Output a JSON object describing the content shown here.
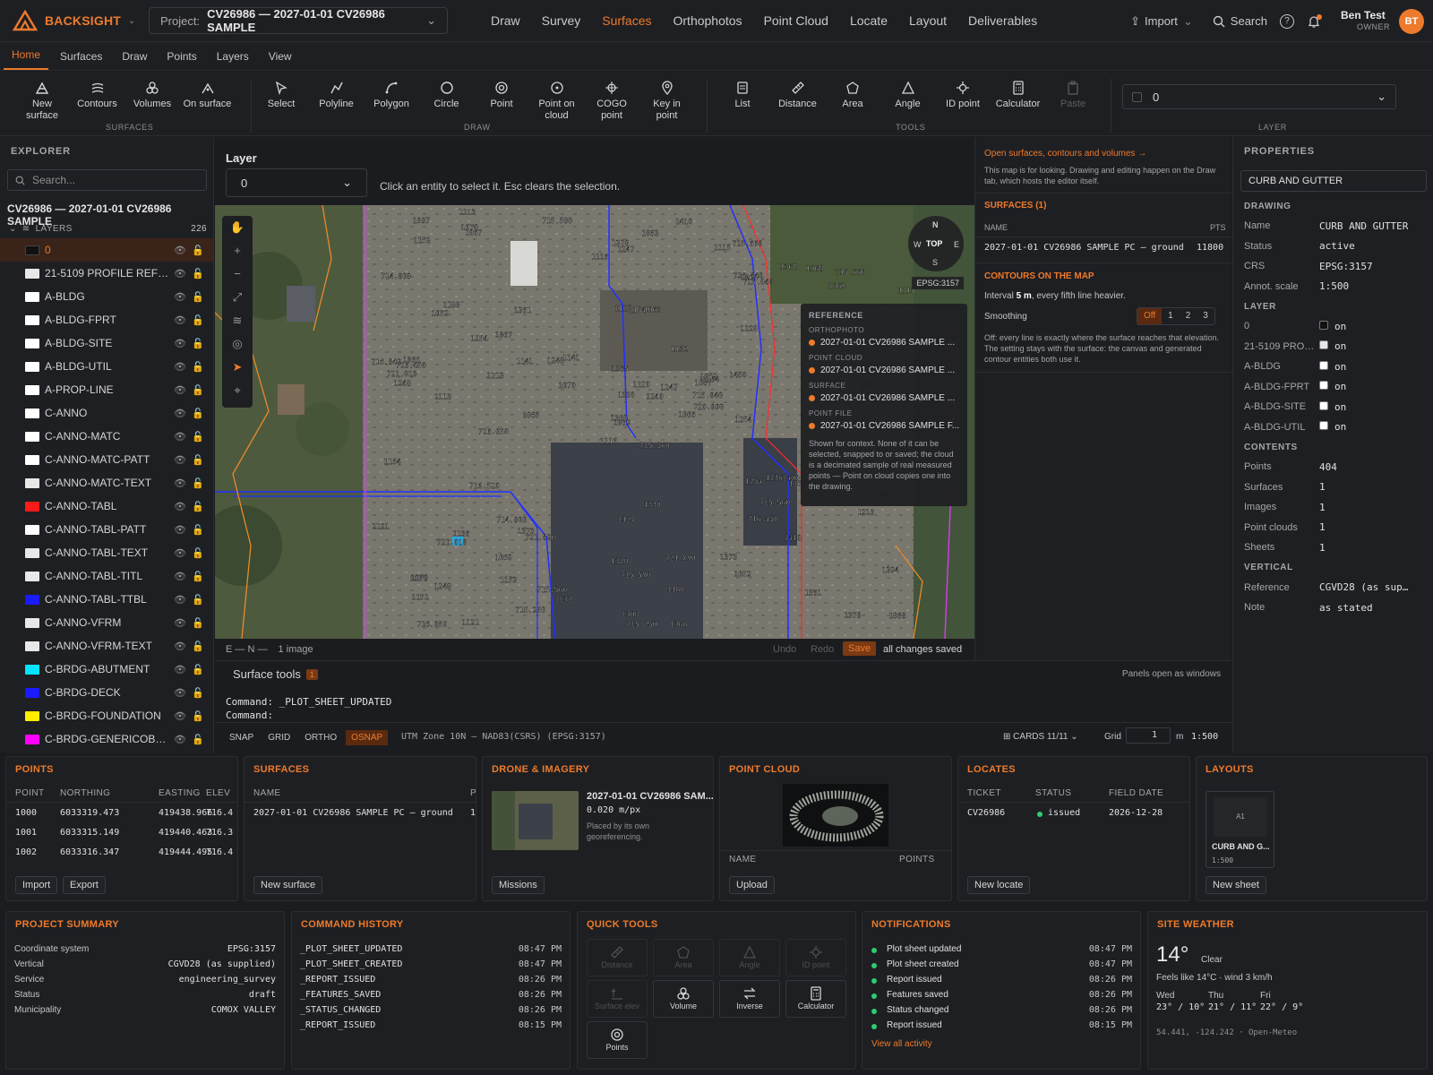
{
  "app": {
    "brand": "BACKSIGHT",
    "project_label": "Project:",
    "project_value": "CV26986 — 2027-01-01 CV26986 SAMPLE",
    "nav": [
      "Draw",
      "Survey",
      "Surfaces",
      "Orthophotos",
      "Point Cloud",
      "Locate",
      "Layout",
      "Deliverables"
    ],
    "nav_active": "Surfaces",
    "import_label": "Import",
    "search_label": "Search",
    "user_name": "Ben Test",
    "user_role": "OWNER",
    "user_initials": "BT",
    "accent_color": "#ee7a2c"
  },
  "ribbon_tabs": [
    "Home",
    "Surfaces",
    "Draw",
    "Points",
    "Layers",
    "View"
  ],
  "ribbon": {
    "surfaces": {
      "group": "SURFACES",
      "buttons": [
        {
          "label": "New\nsurface",
          "icon": "surface-icon"
        },
        {
          "label": "Contours",
          "icon": "contours-icon"
        },
        {
          "label": "Volumes",
          "icon": "volumes-icon"
        },
        {
          "label": "On surface",
          "icon": "on-surface-icon"
        }
      ]
    },
    "draw": {
      "group": "DRAW",
      "buttons": [
        {
          "label": "Select",
          "icon": "cursor-icon"
        },
        {
          "label": "Polyline",
          "icon": "polyline-icon"
        },
        {
          "label": "Polygon",
          "icon": "polygon-icon"
        },
        {
          "label": "Circle",
          "icon": "circle-icon"
        },
        {
          "label": "Point",
          "icon": "point-icon"
        },
        {
          "label": "Point on\ncloud",
          "icon": "point-on-cloud-icon"
        },
        {
          "label": "COGO\npoint",
          "icon": "cogo-icon"
        },
        {
          "label": "Key in\npoint",
          "icon": "key-in-icon"
        }
      ]
    },
    "tools": {
      "group": "TOOLS",
      "buttons": [
        {
          "label": "List",
          "icon": "list-icon"
        },
        {
          "label": "Distance",
          "icon": "ruler-icon"
        },
        {
          "label": "Area",
          "icon": "area-icon"
        },
        {
          "label": "Angle",
          "icon": "angle-icon"
        },
        {
          "label": "ID point",
          "icon": "id-point-icon"
        },
        {
          "label": "Calculator",
          "icon": "calculator-icon"
        },
        {
          "label": "Paste",
          "icon": "paste-icon"
        }
      ]
    },
    "layer": {
      "group": "LAYER",
      "value": "0"
    }
  },
  "explorer": {
    "title": "EXPLORER",
    "search_placeholder": "Search...",
    "project": "CV26986 — 2027-01-01 CV26986 SAMPLE",
    "layers_label": "LAYERS",
    "layers_count": "226",
    "layers": [
      {
        "name": "0",
        "color": "#111111",
        "active": true
      },
      {
        "name": "21-5109 PROFILE REFERE...",
        "color": "#e8e8e8"
      },
      {
        "name": "A-BLDG",
        "color": "#ffffff"
      },
      {
        "name": "A-BLDG-FPRT",
        "color": "#ffffff"
      },
      {
        "name": "A-BLDG-SITE",
        "color": "#ffffff"
      },
      {
        "name": "A-BLDG-UTIL",
        "color": "#ffffff"
      },
      {
        "name": "A-PROP-LINE",
        "color": "#ffffff"
      },
      {
        "name": "C-ANNO",
        "color": "#ffffff"
      },
      {
        "name": "C-ANNO-MATC",
        "color": "#ffffff"
      },
      {
        "name": "C-ANNO-MATC-PATT",
        "color": "#ffffff"
      },
      {
        "name": "C-ANNO-MATC-TEXT",
        "color": "#e8e8e8"
      },
      {
        "name": "C-ANNO-TABL",
        "color": "#ff1a1a"
      },
      {
        "name": "C-ANNO-TABL-PATT",
        "color": "#ffffff"
      },
      {
        "name": "C-ANNO-TABL-TEXT",
        "color": "#e8e8e8"
      },
      {
        "name": "C-ANNO-TABL-TITL",
        "color": "#e8e8e8"
      },
      {
        "name": "C-ANNO-TABL-TTBL",
        "color": "#1a1aff"
      },
      {
        "name": "C-ANNO-VFRM",
        "color": "#e8e8e8"
      },
      {
        "name": "C-ANNO-VFRM-TEXT",
        "color": "#e8e8e8"
      },
      {
        "name": "C-BRDG-ABUTMENT",
        "color": "#00e5ff"
      },
      {
        "name": "C-BRDG-DECK",
        "color": "#1a1aff"
      },
      {
        "name": "C-BRDG-FOUNDATION",
        "color": "#ffee00"
      },
      {
        "name": "C-BRDG-GENERICOBJECT",
        "color": "#ff00ff"
      }
    ]
  },
  "center": {
    "layer_label": "Layer",
    "layer_value": "0",
    "hint": "Click an entity to select it. Esc clears the selection.",
    "compass": {
      "n": "N",
      "s": "S",
      "e": "E",
      "w": "W",
      "mode": "TOP"
    },
    "epsg_tag": "EPSG:3157",
    "reference": {
      "title": "REFERENCE",
      "items": [
        {
          "cat": "ORTHOPHOTO",
          "name": "2027-01-01 CV26986 SAMPLE ..."
        },
        {
          "cat": "POINT CLOUD",
          "name": "2027-01-01 CV26986 SAMPLE ..."
        },
        {
          "cat": "SURFACE",
          "name": "2027-01-01 CV26986 SAMPLE ..."
        },
        {
          "cat": "POINT FILE",
          "name": "2027-01-01 CV26986 SAMPLE F..."
        }
      ],
      "note": "Shown for context. None of it can be selected, snapped to or saved; the cloud is a decimated sample of real measured points — Point on cloud copies one into the drawing."
    },
    "map_labels": [
      "715.560",
      "1052",
      "1069",
      "1070",
      "1087",
      "721.890",
      "715.660",
      "1063",
      "1065",
      "1066",
      "1067",
      "1068",
      "1113",
      "1115",
      "1116",
      "1120",
      "1121",
      "1127",
      "1132",
      "1136",
      "1141",
      "1151",
      "1153",
      "1154",
      "1164",
      "1165",
      "1180",
      "1247",
      "1248",
      "1254",
      "1260",
      "1300",
      "1320",
      "1330",
      "1361",
      "1368",
      "1373",
      "1378",
      "1394",
      "1400",
      "1410",
      "1240",
      "1213",
      "716.450",
      "715.250",
      "716.840",
      "715.040",
      "716.050",
      "715.580",
      "720.000",
      "721.010",
      "716.520",
      "714.800"
    ],
    "status_coords": "E — N —",
    "status_images": "1 image",
    "undo": "Undo",
    "redo": "Redo",
    "save": "Save",
    "saved_status": "all changes saved",
    "surface_tools_label": "Surface tools",
    "surface_tools_count": "1",
    "panels_hint": "Panels open as windows",
    "command_line1": "Command: _PLOT_SHEET_UPDATED",
    "command_line2": "Command:",
    "toggles": [
      "SNAP",
      "GRID",
      "ORTHO",
      "OSNAP"
    ],
    "toggle_active": "OSNAP",
    "crs_text": "UTM Zone 10N — NAD83(CSRS) (EPSG:3157)",
    "cards_label": "CARDS 11/11",
    "grid_label": "Grid",
    "grid_value": "1",
    "grid_unit": "m",
    "scale": "1:500"
  },
  "surfpanel": {
    "link": "Open surfaces, contours and volumes →",
    "intro": "This map is for looking. Drawing and editing happen on the Draw tab, which hosts the editor itself.",
    "surfaces_title": "SURFACES (1)",
    "col_name": "NAME",
    "col_pts": "PTS",
    "surface_name": "2027-01-01 CV26986 SAMPLE PC — ground",
    "surface_pts": "11800",
    "contours_title": "CONTOURS ON THE MAP",
    "interval_pre": "Interval",
    "interval_val": "5 m",
    "interval_post": ", every fifth line heavier.",
    "smoothing_label": "Smoothing",
    "smoothing_opts": [
      "Off",
      "1",
      "2",
      "3"
    ],
    "smoothing_active": "Off",
    "contour_note": "Off: every line is exactly where the surface reaches that elevation. The setting stays with the surface: the canvas and generated contour entities both use it."
  },
  "properties": {
    "title": "PROPERTIES",
    "selected": "CURB AND GUTTER",
    "drawing_h": "DRAWING",
    "drawing": [
      {
        "k": "Name",
        "v": "CURB AND GUTTER"
      },
      {
        "k": "Status",
        "v": "active"
      },
      {
        "k": "CRS",
        "v": "EPSG:3157"
      },
      {
        "k": "Annot. scale",
        "v": "1:500"
      }
    ],
    "layer_h": "LAYER",
    "layer_rows": [
      {
        "k": "0",
        "v": "on",
        "sw": "#111111"
      },
      {
        "k": "21-5109 PROFIL...",
        "v": "on",
        "sw": "#e8e8e8"
      },
      {
        "k": "A-BLDG",
        "v": "on",
        "sw": "#ffffff"
      },
      {
        "k": "A-BLDG-FPRT",
        "v": "on",
        "sw": "#ffffff"
      },
      {
        "k": "A-BLDG-SITE",
        "v": "on",
        "sw": "#ffffff"
      },
      {
        "k": "A-BLDG-UTIL",
        "v": "on",
        "sw": "#ffffff"
      }
    ],
    "contents_h": "CONTENTS",
    "contents": [
      {
        "k": "Points",
        "v": "404"
      },
      {
        "k": "Surfaces",
        "v": "1"
      },
      {
        "k": "Images",
        "v": "1"
      },
      {
        "k": "Point clouds",
        "v": "1"
      },
      {
        "k": "Sheets",
        "v": "1"
      }
    ],
    "vertical_h": "VERTICAL",
    "vertical": [
      {
        "k": "Reference",
        "v": "CGVD28 (as sup…"
      },
      {
        "k": "Note",
        "v": "as stated"
      }
    ]
  },
  "cards": {
    "points": {
      "title": "POINTS",
      "cols": [
        "POINT",
        "NORTHING",
        "EASTING",
        "ELEV"
      ],
      "rows": [
        [
          "1000",
          "6033319.473",
          "419438.966",
          "716.4"
        ],
        [
          "1001",
          "6033315.149",
          "419440.463",
          "716.3"
        ],
        [
          "1002",
          "6033316.347",
          "419444.495",
          "716.4"
        ]
      ],
      "import": "Import",
      "export": "Export"
    },
    "surfaces": {
      "title": "SURFACES",
      "col": "NAME",
      "col2": "P",
      "row": "2027-01-01 CV26986 SAMPLE PC — ground",
      "row2": "1",
      "btn": "New surface"
    },
    "drone": {
      "title": "DRONE & IMAGERY",
      "name": "2027-01-01 CV26986 SAM...",
      "gsd": "0.020 m/px",
      "note": "Placed by its own georeferencing.",
      "btn": "Missions"
    },
    "cloud": {
      "title": "POINT CLOUD",
      "col": "NAME",
      "col2": "POINTS",
      "btn": "Upload"
    },
    "locates": {
      "title": "LOCATES",
      "cols": [
        "TICKET",
        "STATUS",
        "FIELD DATE"
      ],
      "ticket": "CV26986",
      "status": "issued",
      "date": "2026-12-28",
      "btn": "New locate",
      "status_color": "#2ecc71"
    },
    "layouts": {
      "title": "LAYOUTS",
      "sheet": "A1",
      "name": "CURB AND G...",
      "scale": "1:500",
      "btn": "New sheet"
    }
  },
  "summary": {
    "title": "PROJECT SUMMARY",
    "rows": [
      {
        "k": "Coordinate system",
        "v": "EPSG:3157"
      },
      {
        "k": "Vertical",
        "v": "CGVD28 (as supplied)"
      },
      {
        "k": "Service",
        "v": "engineering_survey"
      },
      {
        "k": "Status",
        "v": "draft"
      },
      {
        "k": "Municipality",
        "v": "COMOX VALLEY"
      }
    ]
  },
  "history": {
    "title": "COMMAND HISTORY",
    "rows": [
      {
        "c": "_PLOT_SHEET_UPDATED",
        "t": "08:47 PM"
      },
      {
        "c": "_PLOT_SHEET_CREATED",
        "t": "08:47 PM"
      },
      {
        "c": "_REPORT_ISSUED",
        "t": "08:26 PM"
      },
      {
        "c": "_FEATURES_SAVED",
        "t": "08:26 PM"
      },
      {
        "c": "_STATUS_CHANGED",
        "t": "08:26 PM"
      },
      {
        "c": "_REPORT_ISSUED",
        "t": "08:15 PM"
      }
    ]
  },
  "quicktools": {
    "title": "QUICK TOOLS",
    "items": [
      {
        "label": "Distance",
        "icon": "ruler-icon",
        "enabled": false
      },
      {
        "label": "Area",
        "icon": "area-icon",
        "enabled": false
      },
      {
        "label": "Angle",
        "icon": "angle-icon",
        "enabled": false
      },
      {
        "label": "ID point",
        "icon": "id-point-icon",
        "enabled": false
      },
      {
        "label": "Surface elev",
        "icon": "surface-elev-icon",
        "enabled": false
      },
      {
        "label": "Volume",
        "icon": "volumes-icon",
        "enabled": true
      },
      {
        "label": "Inverse",
        "icon": "inverse-icon",
        "enabled": true
      },
      {
        "label": "Calculator",
        "icon": "calculator-icon",
        "enabled": true
      },
      {
        "label": "Points",
        "icon": "point-icon",
        "enabled": true
      }
    ]
  },
  "notifications": {
    "title": "NOTIFICATIONS",
    "rows": [
      {
        "m": "Plot sheet updated",
        "t": "08:47 PM"
      },
      {
        "m": "Plot sheet created",
        "t": "08:47 PM"
      },
      {
        "m": "Report issued",
        "t": "08:26 PM"
      },
      {
        "m": "Features saved",
        "t": "08:26 PM"
      },
      {
        "m": "Status changed",
        "t": "08:26 PM"
      },
      {
        "m": "Report issued",
        "t": "08:15 PM"
      }
    ],
    "view_all": "View all activity",
    "dot_color": "#2ecc71"
  },
  "weather": {
    "title": "SITE WEATHER",
    "temp": "14°",
    "cond": "Clear",
    "feels": "Feels like 14°C · wind 3 km/h",
    "days": [
      {
        "d": "Wed",
        "r": "23° / 10°"
      },
      {
        "d": "Thu",
        "r": "21° / 11°"
      },
      {
        "d": "Fri",
        "r": "22° / 9°"
      }
    ],
    "coords": "54.441, -124.242 · Open-Meteo"
  }
}
